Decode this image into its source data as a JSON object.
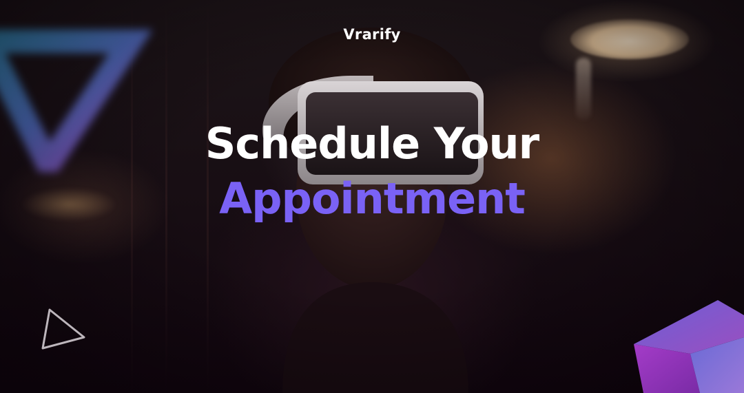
{
  "brand": {
    "name": "Vrarify"
  },
  "hero": {
    "headline_line1": "Schedule Your",
    "headline_line2": "Appointment"
  },
  "colors": {
    "headline_primary": "#ffffff",
    "headline_accent": "#7a62f5",
    "background_dark": "#14090f",
    "cube_purple": "#8a2fb0",
    "cube_blue": "#6a5fc8"
  },
  "decor": {
    "outline_triangle_icon": "triangle-outline-icon",
    "cube_icon": "cube-icon"
  }
}
